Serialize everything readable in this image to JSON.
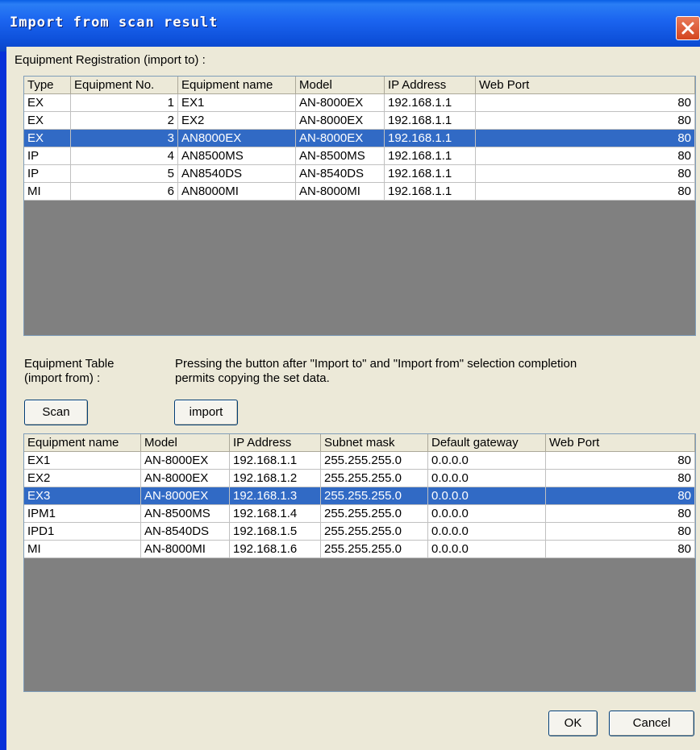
{
  "window": {
    "title": "Import from scan result"
  },
  "registration": {
    "label": "Equipment Registration (import to) :",
    "columns": [
      "Type",
      "Equipment No.",
      "Equipment name",
      "Model",
      "IP Address",
      "Web Port"
    ],
    "rows": [
      {
        "type": "EX",
        "no": "1",
        "name": "EX1",
        "model": "AN-8000EX",
        "ip": "192.168.1.1",
        "port": "80"
      },
      {
        "type": "EX",
        "no": "2",
        "name": "EX2",
        "model": "AN-8000EX",
        "ip": "192.168.1.1",
        "port": "80"
      },
      {
        "type": "EX",
        "no": "3",
        "name": "AN8000EX",
        "model": "AN-8000EX",
        "ip": "192.168.1.1",
        "port": "80"
      },
      {
        "type": "IP",
        "no": "4",
        "name": "AN8500MS",
        "model": "AN-8500MS",
        "ip": "192.168.1.1",
        "port": "80"
      },
      {
        "type": "IP",
        "no": "5",
        "name": "AN8540DS",
        "model": "AN-8540DS",
        "ip": "192.168.1.1",
        "port": "80"
      },
      {
        "type": "MI",
        "no": "6",
        "name": "AN8000MI",
        "model": "AN-8000MI",
        "ip": "192.168.1.1",
        "port": "80"
      }
    ],
    "selected_index": 2
  },
  "equipment_table": {
    "label_line1": "Equipment Table",
    "label_line2": "(import from) :",
    "instruction_line1": "Pressing the button after \"Import to\" and \"Import from\" selection completion",
    "instruction_line2": "permits copying the set data.",
    "scan_label": "Scan",
    "import_label": "import",
    "columns": [
      "Equipment name",
      "Model",
      "IP Address",
      "Subnet mask",
      "Default gateway",
      "Web Port"
    ],
    "rows": [
      {
        "name": "EX1",
        "model": "AN-8000EX",
        "ip": "192.168.1.1",
        "mask": "255.255.255.0",
        "gw": "0.0.0.0",
        "port": "80"
      },
      {
        "name": "EX2",
        "model": "AN-8000EX",
        "ip": "192.168.1.2",
        "mask": "255.255.255.0",
        "gw": "0.0.0.0",
        "port": "80"
      },
      {
        "name": "EX3",
        "model": "AN-8000EX",
        "ip": "192.168.1.3",
        "mask": "255.255.255.0",
        "gw": "0.0.0.0",
        "port": "80"
      },
      {
        "name": "IPM1",
        "model": "AN-8500MS",
        "ip": "192.168.1.4",
        "mask": "255.255.255.0",
        "gw": "0.0.0.0",
        "port": "80"
      },
      {
        "name": "IPD1",
        "model": "AN-8540DS",
        "ip": "192.168.1.5",
        "mask": "255.255.255.0",
        "gw": "0.0.0.0",
        "port": "80"
      },
      {
        "name": "MI",
        "model": "AN-8000MI",
        "ip": "192.168.1.6",
        "mask": "255.255.255.0",
        "gw": "0.0.0.0",
        "port": "80"
      }
    ],
    "selected_index": 2
  },
  "footer": {
    "ok_label": "OK",
    "cancel_label": "Cancel"
  },
  "colors": {
    "selection": "#316ac5",
    "titlebar": "#0a50dc",
    "dialog_bg": "#ece9d8",
    "grid_empty": "#808080"
  }
}
